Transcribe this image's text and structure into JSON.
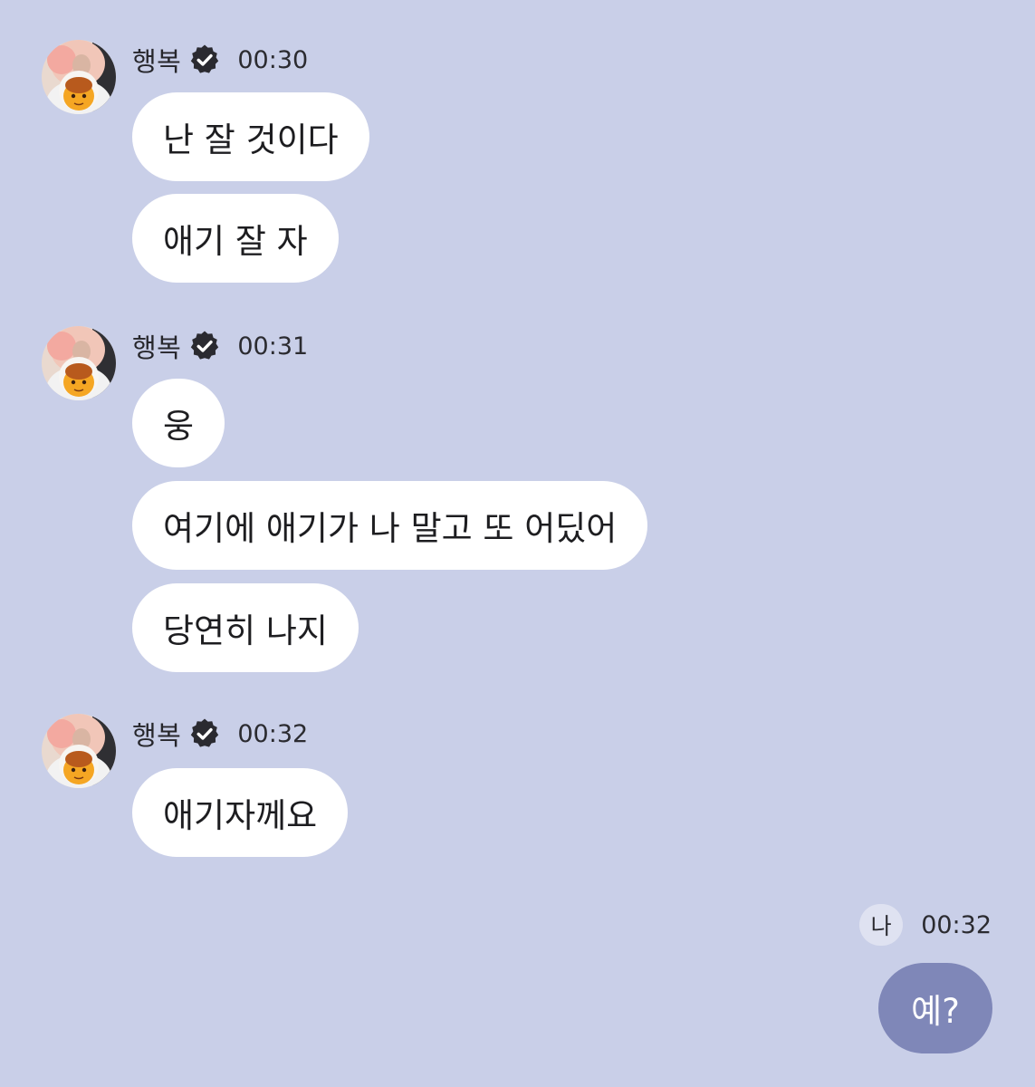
{
  "colors": {
    "background": "#c9cfe8",
    "incoming_bubble": "#ffffff",
    "outgoing_bubble": "#7f87b8",
    "verified_badge": "#2a2a30"
  },
  "groups": [
    {
      "sender": "행복",
      "time": "00:30",
      "verified_icon": "verified-check-icon",
      "messages": [
        "난 잘 것이다",
        "애기 잘 자"
      ]
    },
    {
      "sender": "행복",
      "time": "00:31",
      "verified_icon": "verified-check-icon",
      "messages": [
        "웅",
        "여기에 애기가 나 말고 또 어딨어",
        "당연히 나지"
      ]
    },
    {
      "sender": "행복",
      "time": "00:32",
      "verified_icon": "verified-check-icon",
      "messages": [
        "애기자께요"
      ]
    }
  ],
  "me": {
    "tag": "나",
    "time": "00:32",
    "message": "예?"
  }
}
